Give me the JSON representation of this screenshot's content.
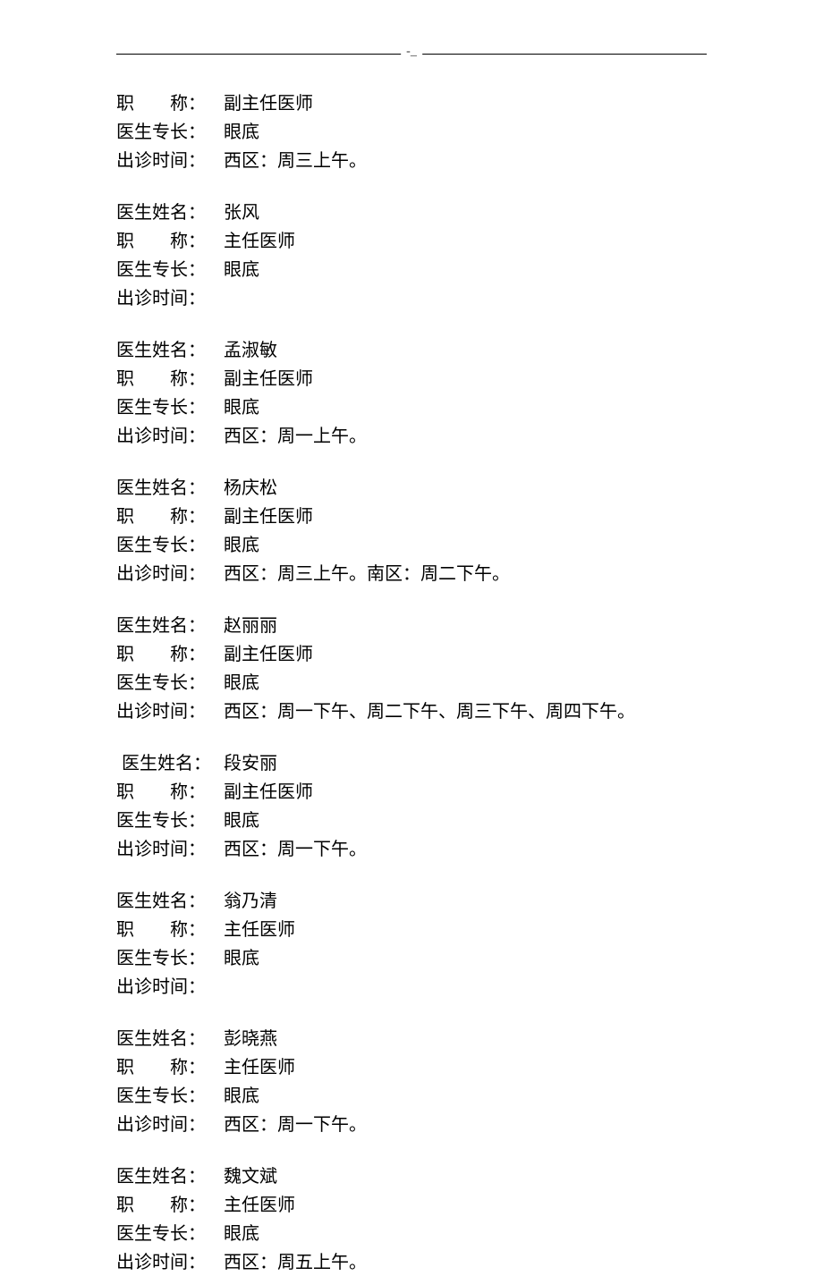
{
  "header_mark": "-_",
  "labels": {
    "name": "医生姓名：",
    "title": "职　　称：",
    "specialty": "医生专长：",
    "schedule": "出诊时间："
  },
  "first_partial": {
    "title": "副主任医师",
    "specialty": "眼底",
    "schedule": "西区：周三上午。"
  },
  "doctors": [
    {
      "name": "张风",
      "title": "主任医师",
      "specialty": "眼底",
      "schedule": ""
    },
    {
      "name": "孟淑敏",
      "title": "副主任医师",
      "specialty": "眼底",
      "schedule": "西区：周一上午。"
    },
    {
      "name": "杨庆松",
      "title": "副主任医师",
      "specialty": "眼底",
      "schedule": "西区：周三上午。南区：周二下午。"
    },
    {
      "name": "赵丽丽",
      "title": "副主任医师",
      "specialty": "眼底",
      "schedule": "西区：周一下午、周二下午、周三下午、周四下午。"
    },
    {
      "name": "段安丽",
      "title": "副主任医师",
      "specialty": "眼底",
      "schedule": "西区：周一下午。",
      "indented": true
    },
    {
      "name": "翁乃清",
      "title": "主任医师",
      "specialty": "眼底",
      "schedule": ""
    },
    {
      "name": "彭晓燕",
      "title": "主任医师",
      "specialty": "眼底",
      "schedule": "西区：周一下午。"
    },
    {
      "name": "魏文斌",
      "title": "主任医师",
      "specialty": "眼底",
      "schedule": "西区：周五上午。"
    }
  ]
}
